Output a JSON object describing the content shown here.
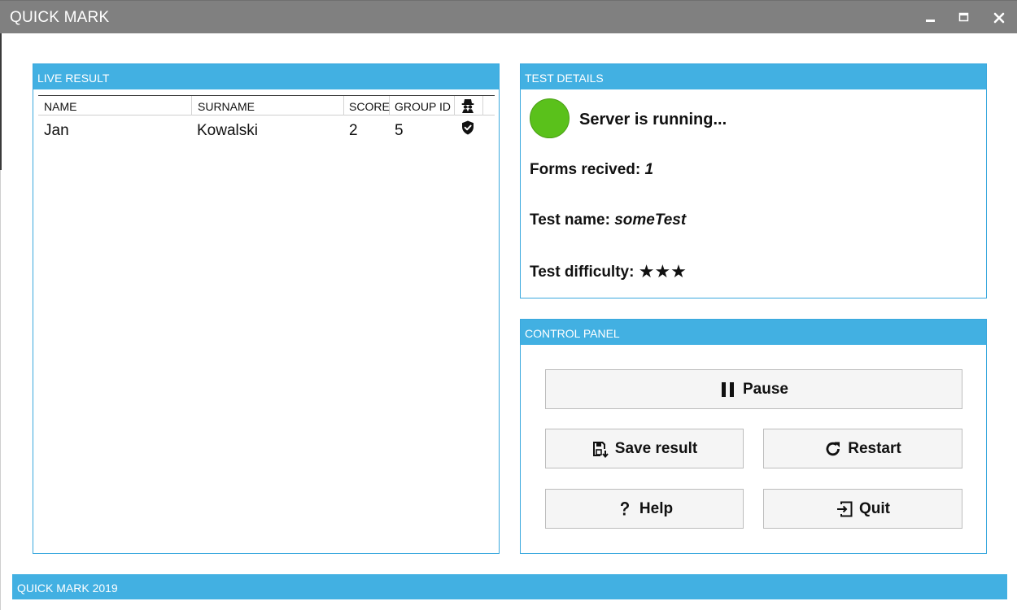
{
  "window": {
    "title": "QUICK MARK",
    "controls": [
      "minimize-icon",
      "maximize-icon",
      "close-icon"
    ]
  },
  "live_result": {
    "header": "LIVE RESULT",
    "columns": {
      "name": "NAME",
      "surname": "SURNAME",
      "score": "SCORE",
      "group_id": "GROUP ID",
      "status_icon": "spy-icon"
    },
    "rows": [
      {
        "name": "Jan",
        "surname": "Kowalski",
        "score": "2",
        "group_id": "5",
        "status_icon": "shield-check-icon"
      }
    ]
  },
  "test_details": {
    "header": "TEST DETAILS",
    "status_text": "Server is running...",
    "status_color": "#5ac11b",
    "forms_label": "Forms recived: ",
    "forms_value": "1",
    "name_label": "Test name: ",
    "name_value": "someTest",
    "difficulty_label": "Test difficulty: ",
    "difficulty_stars": "★★★"
  },
  "control_panel": {
    "header": "CONTROL PANEL",
    "buttons": {
      "pause": "Pause",
      "save": "Save result",
      "restart": "Restart",
      "help": "Help",
      "quit": "Quit"
    }
  },
  "footer": {
    "text": "QUICK MARK 2019"
  },
  "colors": {
    "accent": "#42b0e2",
    "titlebar": "#808080",
    "status_green": "#5ac11b"
  }
}
